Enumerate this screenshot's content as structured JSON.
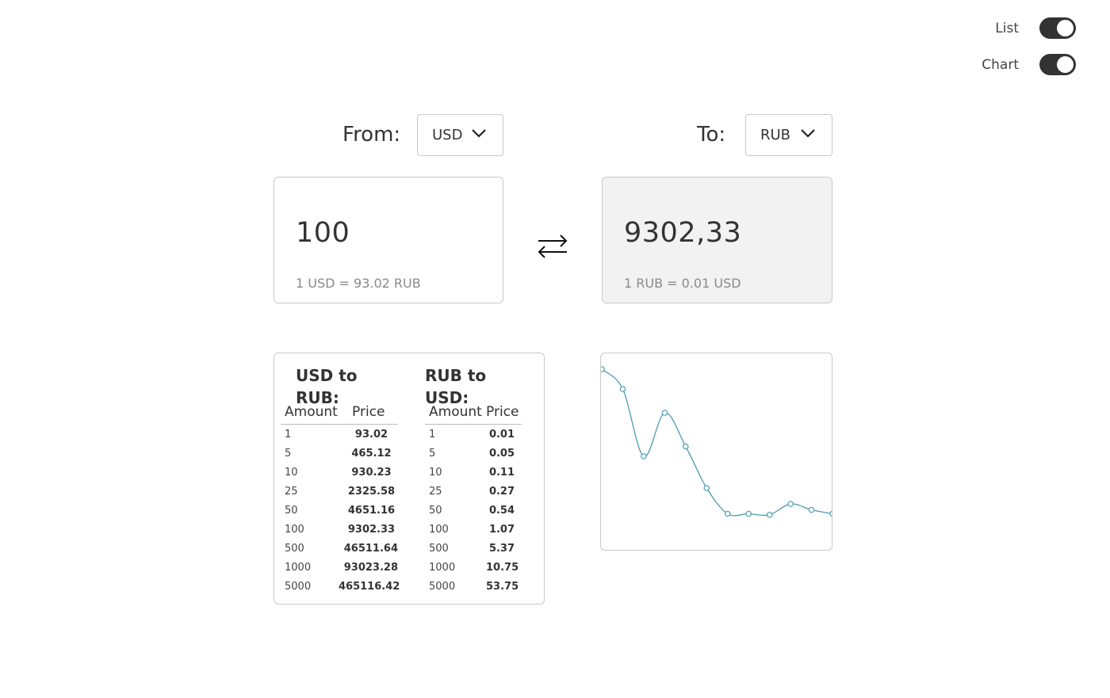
{
  "toggles": {
    "list": {
      "label": "List",
      "on": true
    },
    "chart": {
      "label": "Chart",
      "on": true
    }
  },
  "converter": {
    "from_label": "From:",
    "to_label": "To:",
    "from_currency": "USD",
    "to_currency": "RUB",
    "from_amount": "100",
    "to_amount": "9302,33",
    "from_rate_text": "1 USD = 93.02 RUB",
    "to_rate_text": "1 RUB = 0.01 USD"
  },
  "list": {
    "left": {
      "title": "USD to RUB:",
      "col_amount": "Amount",
      "col_price": "Price",
      "rows": [
        {
          "amount": "1",
          "price": "93.02"
        },
        {
          "amount": "5",
          "price": "465.12"
        },
        {
          "amount": "10",
          "price": "930.23"
        },
        {
          "amount": "25",
          "price": "2325.58"
        },
        {
          "amount": "50",
          "price": "4651.16"
        },
        {
          "amount": "100",
          "price": "9302.33"
        },
        {
          "amount": "500",
          "price": "46511.64"
        },
        {
          "amount": "1000",
          "price": "93023.28"
        },
        {
          "amount": "5000",
          "price": "465116.42"
        }
      ]
    },
    "right": {
      "title": "RUB to USD:",
      "col_amount": "Amount",
      "col_price": "Price",
      "rows": [
        {
          "amount": "1",
          "price": "0.01"
        },
        {
          "amount": "5",
          "price": "0.05"
        },
        {
          "amount": "10",
          "price": "0.11"
        },
        {
          "amount": "25",
          "price": "0.27"
        },
        {
          "amount": "50",
          "price": "0.54"
        },
        {
          "amount": "100",
          "price": "1.07"
        },
        {
          "amount": "500",
          "price": "5.37"
        },
        {
          "amount": "1000",
          "price": "10.75"
        },
        {
          "amount": "5000",
          "price": "53.75"
        }
      ]
    }
  },
  "chart_data": {
    "type": "line",
    "x": [
      1,
      2,
      3,
      4,
      5,
      6,
      7,
      8,
      9,
      10,
      11,
      12
    ],
    "values": [
      0.92,
      0.82,
      0.48,
      0.7,
      0.53,
      0.32,
      0.19,
      0.19,
      0.185,
      0.24,
      0.21,
      0.19
    ],
    "ylim": [
      0,
      1
    ],
    "grid": false,
    "line_color": "#4a9bb0"
  },
  "colors": {
    "toggle_on": "#333333",
    "accent_line": "#4a9bb0",
    "result_bg": "#f2f2f2"
  }
}
